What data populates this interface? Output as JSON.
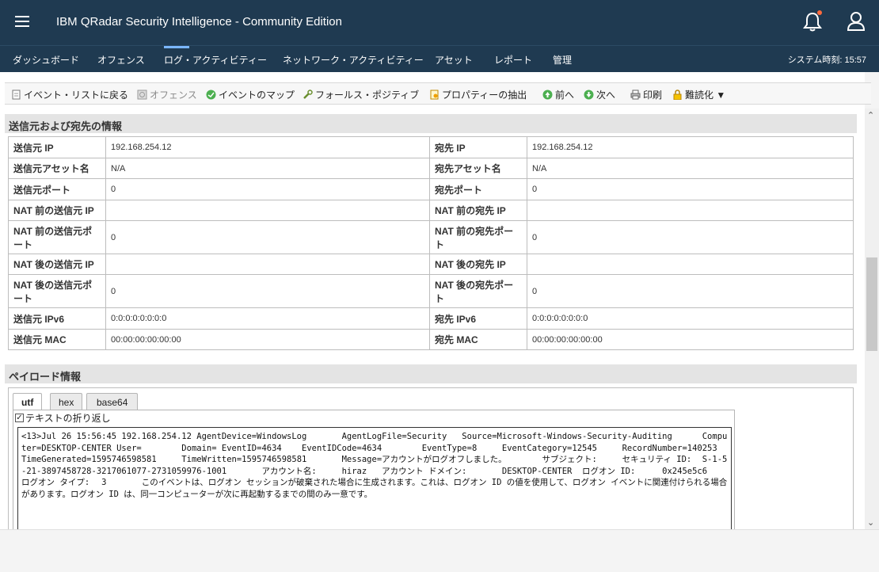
{
  "header": {
    "title": "IBM QRadar Security Intelligence - Community Edition",
    "menu_icon": "hamburger-icon",
    "notification_icon": "bell-icon",
    "user_icon": "user-icon",
    "accent": "#1f3a51"
  },
  "nav": {
    "items": [
      "ダッシュボード",
      "オフェンス",
      "ログ・アクティビティー",
      "ネットワーク・アクティビティー",
      "アセット",
      "レポート",
      "管理"
    ],
    "active": "ログ・アクティビティー",
    "system_time": "システム時刻: 15:57"
  },
  "toolbar": {
    "back": "イベント・リストに戻る",
    "offense": "オフェンス",
    "map": "イベントのマップ",
    "false_positive": "フォールス・ポジティブ",
    "extract": "プロパティーの抽出",
    "prev": "前へ",
    "next": "次へ",
    "print": "印刷",
    "obfuscate": "難読化 ▼"
  },
  "source_dest": {
    "title": "送信元および宛先の情報",
    "rows": [
      {
        "l1": "送信元 IP",
        "v1": "192.168.254.12",
        "l2": "宛先 IP",
        "v2": "192.168.254.12"
      },
      {
        "l1": "送信元アセット名",
        "v1": "N/A",
        "l2": "宛先アセット名",
        "v2": "N/A"
      },
      {
        "l1": "送信元ポート",
        "v1": "0",
        "l2": "宛先ポート",
        "v2": "0"
      },
      {
        "l1": "NAT 前の送信元 IP",
        "v1": "",
        "l2": "NAT 前の宛先 IP",
        "v2": ""
      },
      {
        "l1": "NAT 前の送信元ポート",
        "v1": "0",
        "l2": "NAT 前の宛先ポート",
        "v2": "0"
      },
      {
        "l1": "NAT 後の送信元 IP",
        "v1": "",
        "l2": "NAT 後の宛先 IP",
        "v2": ""
      },
      {
        "l1": "NAT 後の送信元ポート",
        "v1": "0",
        "l2": "NAT 後の宛先ポート",
        "v2": "0"
      },
      {
        "l1": "送信元 IPv6",
        "v1": "0:0:0:0:0:0:0:0",
        "l2": "宛先 IPv6",
        "v2": "0:0:0:0:0:0:0:0"
      },
      {
        "l1": "送信元 MAC",
        "v1": "00:00:00:00:00:00",
        "l2": "宛先 MAC",
        "v2": "00:00:00:00:00:00"
      }
    ]
  },
  "payload": {
    "title": "ペイロード情報",
    "tabs": [
      "utf",
      "hex",
      "base64"
    ],
    "active_tab": "utf",
    "wrap_label": "テキストの折り返し",
    "wrap_checked": true,
    "text": "<13>Jul 26 15:56:45 192.168.254.12 AgentDevice=WindowsLog\tAgentLogFile=Security\tSource=Microsoft-Windows-Security-Auditing\tComputer=DESKTOP-CENTER User=\tDomain= EventID=4634\tEventIDCode=4634\tEventType=8\tEventCategory=12545\tRecordNumber=140253\tTimeGenerated=1595746598581\tTimeWritten=1595746598581\tMessage=アカウントがログオフしました。\tサブジェクト:\tセキュリティ ID:\tS-1-5-21-3897458728-3217061077-2731059976-1001\tアカウント名:\thiraz\tアカウント ドメイン:\tDESKTOP-CENTER\tログオン ID:\t0x245e5c6\tログオン タイプ:\t3\tこのイベントは、ログオン セッションが破棄された場合に生成されます。これは、ログオン ID の値を使用して、ログオン イベントに関連付けられる場合があります。ログオン ID は、同一コンピューターが次に再起動するまでの間のみ一意です。"
  }
}
